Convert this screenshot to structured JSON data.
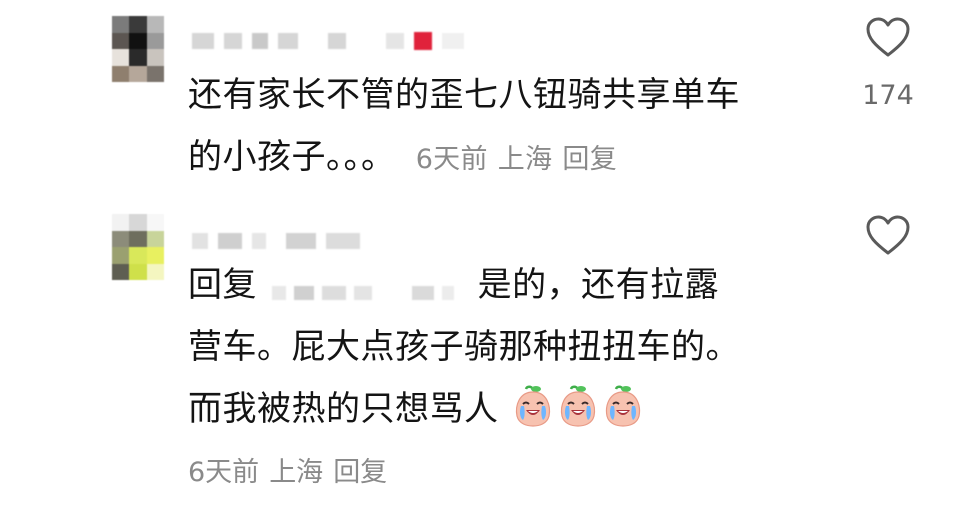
{
  "comments": [
    {
      "text_line1": "还有家长不管的歪七八钮骑共享单车",
      "text_line2": "的小孩子。。。",
      "time": "6天前",
      "location": "上海",
      "reply_label": "回复",
      "like_count": "174",
      "heart_icon": "heart-outline-icon"
    },
    {
      "reply_prefix": "回复",
      "text_line1_after_mention": "是的，还有拉露",
      "text_line2": "营车。屁大点孩子骑那种扭扭车的。",
      "text_line3": "而我被热的只想骂人",
      "emoji_icon": "crying-peach-emoji-icon",
      "emoji_count": 3,
      "time": "6天前",
      "location": "上海",
      "reply_label": "回复",
      "heart_icon": "heart-outline-icon"
    }
  ],
  "colors": {
    "text": "#141414",
    "meta": "#8a8a8a",
    "heart_stroke": "#5a5a5a",
    "mosaic_accent": "#e0223b"
  }
}
